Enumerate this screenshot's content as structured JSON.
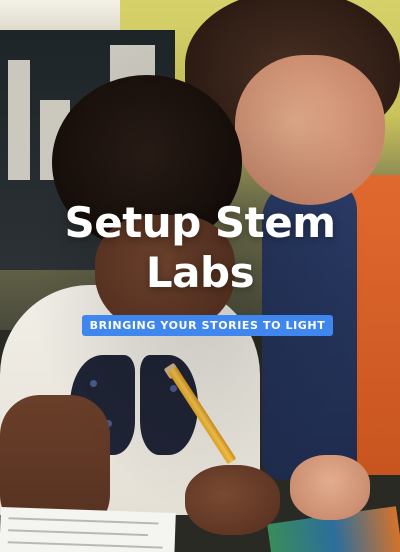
{
  "poster": {
    "title_line_1": "Setup Stem",
    "title_line_2": "Labs",
    "tagline": "BRINGING YOUR STORIES TO LIGHT",
    "colors": {
      "tagline_background": "#3f86ee",
      "title_text": "#ffffff"
    }
  }
}
